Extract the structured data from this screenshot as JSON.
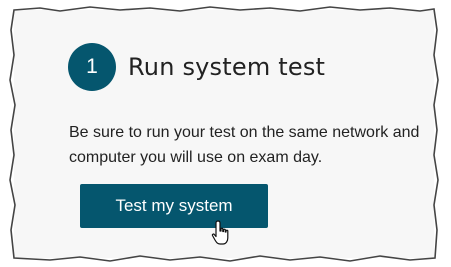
{
  "step": {
    "number": "1",
    "title": "Run system test"
  },
  "instructions": {
    "text": "Be sure to run your test on the same network and computer you will use on exam day."
  },
  "actions": {
    "test_button_label": "Test my system"
  },
  "colors": {
    "accent": "#05566e",
    "card_background": "#f7f7f7",
    "text": "#222222"
  },
  "icons": {
    "cursor": "hand-pointer-icon"
  }
}
